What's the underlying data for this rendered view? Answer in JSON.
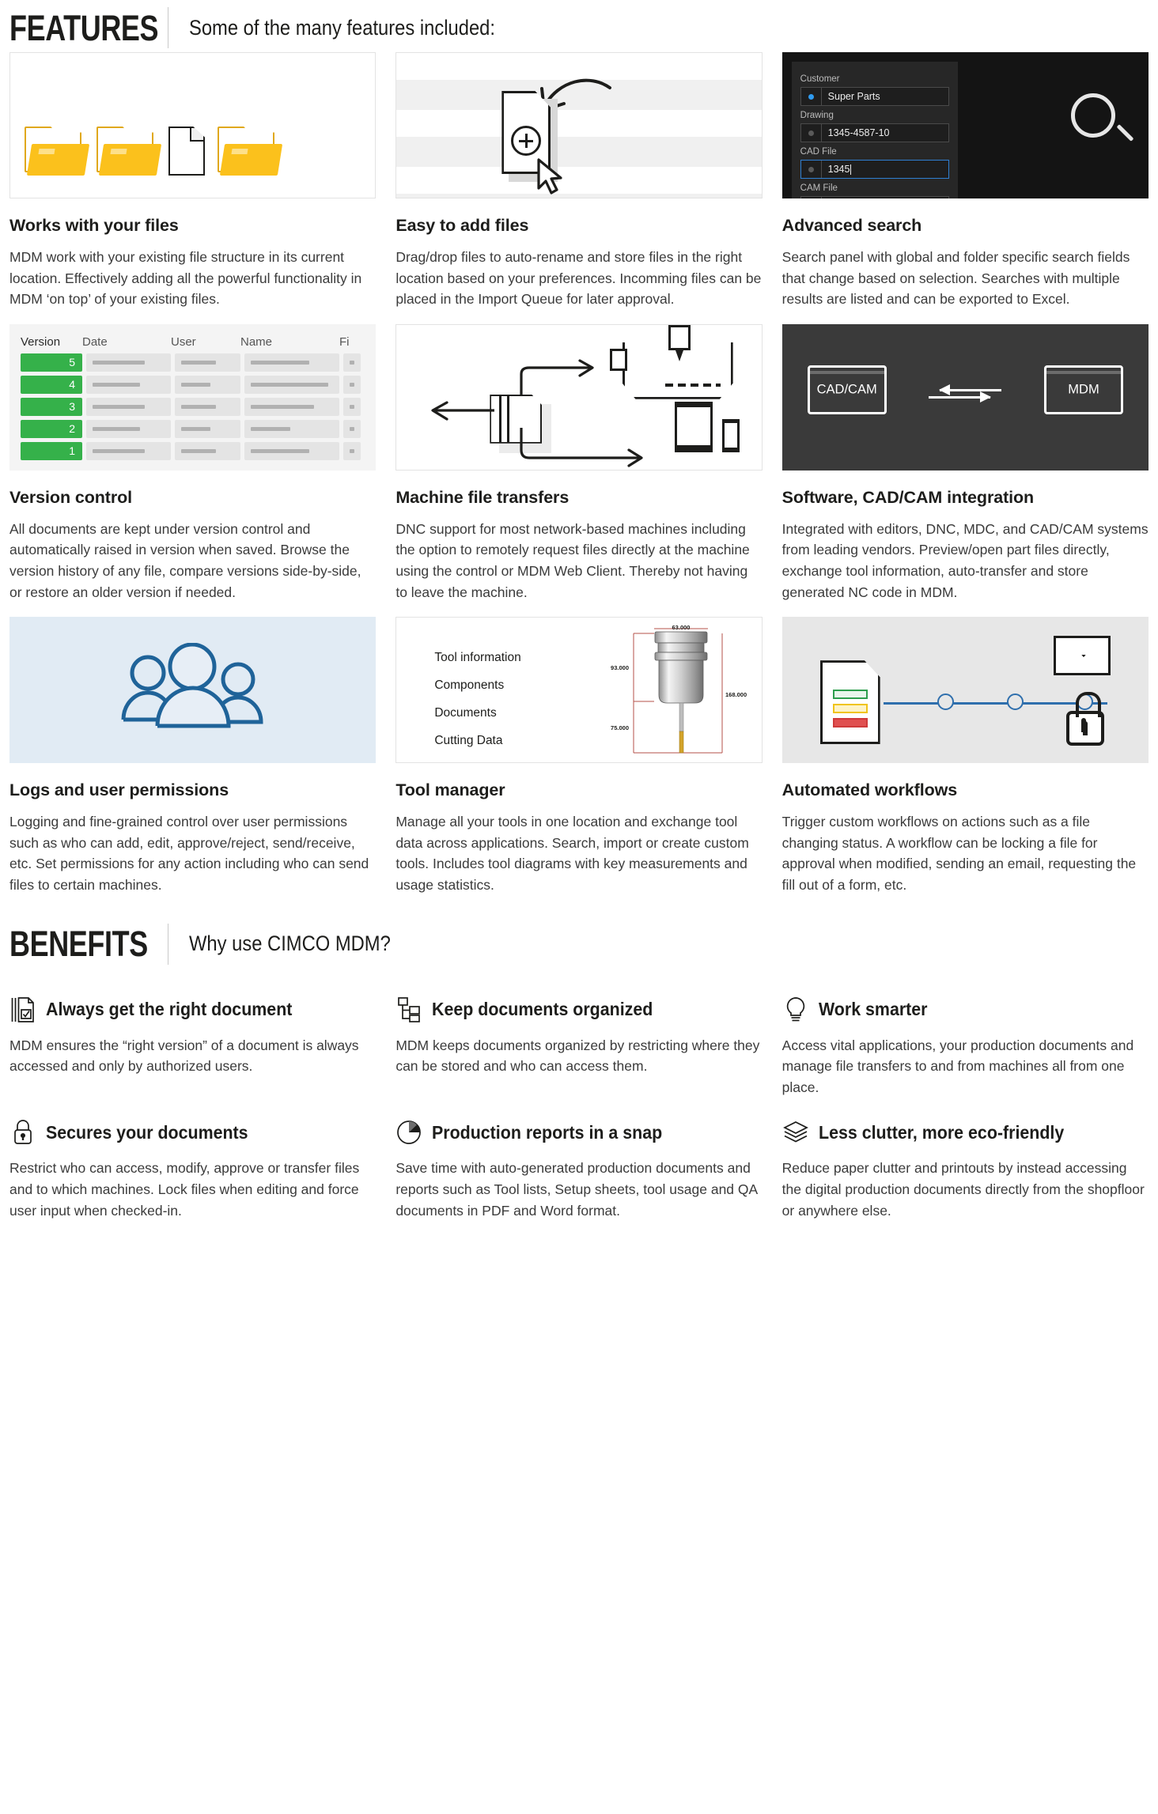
{
  "features_section": {
    "title": "FEATURES",
    "subtitle": "Some of the many features included:"
  },
  "features": [
    {
      "title": "Works with your files",
      "body": "MDM work with your existing file structure in its current location. Effectively adding all the powerful functionality in MDM ‘on top’ of your existing files.",
      "media": "folders-and-document"
    },
    {
      "title": "Easy to add files",
      "body": "Drag/drop files to auto-rename and store files in the right location based on your preferences. Incomming files can be placed in the Import Queue for later approval.",
      "media": "drag-drop-add-file"
    },
    {
      "title": "Advanced search",
      "body": "Search panel with global and folder specific search fields that change based on selection. Searches with multiple results are listed and can be exported to Excel.",
      "media": "dark-search-panel",
      "search_panel": {
        "fields": [
          {
            "label": "Customer",
            "value": "Super Parts",
            "dot": "blue",
            "focused": false
          },
          {
            "label": "Drawing",
            "value": "1345-4587-10",
            "dot": "gray",
            "focused": false
          },
          {
            "label": "CAD File",
            "value": "1345",
            "dot": "gray",
            "focused": true
          },
          {
            "label": "CAM File",
            "value": "",
            "dot": "gray",
            "focused": false
          }
        ]
      }
    },
    {
      "title": "Version control",
      "body": "All documents are kept under version control and automatically raised in version when saved. Browse the version history of any file, compare versions side-by-side, or restore an older version if needed.",
      "media": "version-table",
      "version_table": {
        "columns": [
          "Version",
          "Date",
          "User",
          "Name",
          "Fi"
        ],
        "rows": [
          "5",
          "4",
          "3",
          "2",
          "1"
        ]
      }
    },
    {
      "title": "Machine file transfers",
      "body": "DNC support for most network-based machines including the option to remotely request files directly at the machine using the control or MDM Web Client. Thereby not having to leave the machine.",
      "media": "machine-transfer-diagram"
    },
    {
      "title": "Software, CAD/CAM integration",
      "body": "Integrated with editors, DNC, MDC, and CAD/CAM systems from leading vendors. Preview/open part files directly, exchange tool information, auto-transfer and store generated NC code in MDM.",
      "media": "cadcam-mdm-exchange",
      "diagram": {
        "left_window": "CAD/CAM",
        "right_window": "MDM"
      }
    },
    {
      "title": "Logs and user permissions",
      "body": "Logging and fine-grained control over user permissions such as who can add, edit, approve/reject, send/receive, etc. Set permissions for any action including who can send files to certain machines.",
      "media": "three-people-icon"
    },
    {
      "title": "Tool manager",
      "body": "Manage all your tools in one location and exchange tool data across applications. Search, import or create custom tools. Includes tool diagrams with key measurements and usage statistics.",
      "media": "tool-diagram",
      "tool_panel": {
        "items": [
          "Tool information",
          "Components",
          "Documents",
          "Cutting Data"
        ],
        "dimensions": {
          "width_top": "63.000",
          "height_body": "93.000",
          "height_total": "168.000",
          "length_shank": "75.000"
        }
      }
    },
    {
      "title": "Automated workflows",
      "body": "Trigger custom workflows on actions such as a file changing status. A workflow can be locking a file for approval when modified, sending an email, requesting the fill out of a form, etc.",
      "media": "workflow-diagram"
    }
  ],
  "benefits_section": {
    "title": "BENEFITS",
    "subtitle": "Why use CIMCO MDM?"
  },
  "benefits": [
    {
      "icon": "document-check-icon",
      "title": "Always get the right document",
      "body": "MDM ensures the “right version” of a document is always accessed and only by authorized users."
    },
    {
      "icon": "org-chart-icon",
      "title": "Keep documents organized",
      "body": "MDM keeps documents organized by restricting where they can be stored and who can access them."
    },
    {
      "icon": "lightbulb-icon",
      "title": "Work smarter",
      "body": "Access vital applications, your production documents and manage file transfers to and from machines all from one place."
    },
    {
      "icon": "lock-icon",
      "title": "Secures your documents",
      "body": "Restrict who can access, modify, approve or transfer files and to which machines. Lock files when editing and force user input when checked-in."
    },
    {
      "icon": "pie-chart-icon",
      "title": "Production reports in a snap",
      "body": "Save time with auto-generated production documents and reports such as Tool lists, Setup sheets, tool usage and QA documents in PDF and Word format."
    },
    {
      "icon": "stacked-papers-icon",
      "title": "Less clutter, more eco-friendly",
      "body": "Reduce paper clutter and printouts by instead accessing the digital production documents directly from the shopfloor or anywhere else."
    }
  ],
  "colors": {
    "folder_yellow": "#fbc11c",
    "version_green": "#35b14a",
    "accent_blue": "#2f6fad",
    "people_blue": "#1f6399",
    "dark_panel": "#141414",
    "gray_panel": "#3a3a3a"
  }
}
